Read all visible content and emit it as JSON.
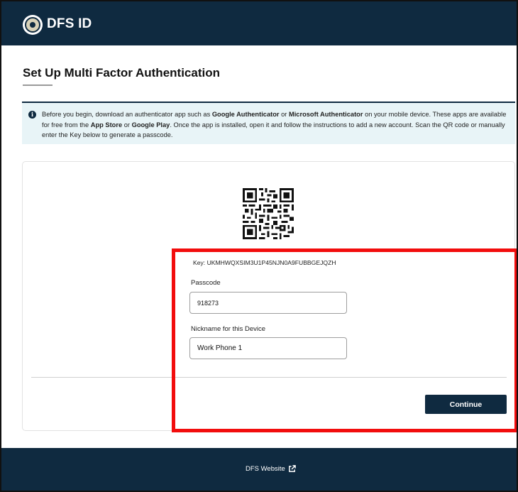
{
  "header": {
    "brand": "DFS ID",
    "seal_icon": "state-seal-logo"
  },
  "page": {
    "title": "Set Up Multi Factor Authentication"
  },
  "info": {
    "icon": "info-icon",
    "text_1": "Before you begin, download an authenticator app such as ",
    "google_auth": "Google Authenticator",
    "or_1": " or ",
    "microsoft_auth": "Microsoft Authenticator",
    "text_2": " on your mobile device. These apps are available for free from the ",
    "app_store": "App Store",
    "or_2": " or ",
    "google_play": "Google Play",
    "text_3": ". Once the app is installed, open it and follow the instructions to add a new account. Scan the QR code or manually enter the Key below to generate a passcode."
  },
  "setup": {
    "qr_icon": "qr-code",
    "key_line": "Key: UKMHWQXSIM3U1P45NJN0A9FUBBGEJQZH",
    "passcode_label": "Passcode",
    "passcode_value": "918273",
    "nickname_label": "Nickname for this Device",
    "nickname_value": "Work Phone 1",
    "continue_label": "Continue"
  },
  "footer": {
    "link_label": "DFS Website",
    "link_icon": "external-link-icon"
  },
  "colors": {
    "navy": "#0f2a40",
    "info_bg": "#e8f4f7",
    "highlight": "#f20d0d"
  }
}
